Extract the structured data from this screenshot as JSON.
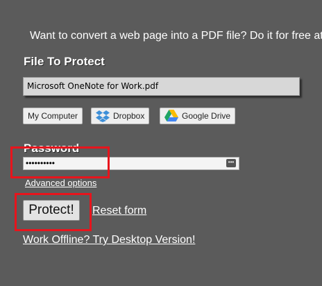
{
  "promo_text": "Want to convert a web page into a PDF file? Do it for free at",
  "file_section": {
    "title": "File To Protect",
    "file_name": "Microsoft OneNote for Work.pdf"
  },
  "sources": {
    "my_computer": "My Computer",
    "dropbox": "Dropbox",
    "google_drive": "Google Drive"
  },
  "password": {
    "label": "Password",
    "masked_value": "••••••••••"
  },
  "advanced_options": "Advanced options",
  "actions": {
    "protect": "Protect!",
    "reset": "Reset form"
  },
  "offline_link": "Work Offline? Try Desktop Version!",
  "colors": {
    "background": "#5b5b5b",
    "highlight": "#e8141c"
  }
}
